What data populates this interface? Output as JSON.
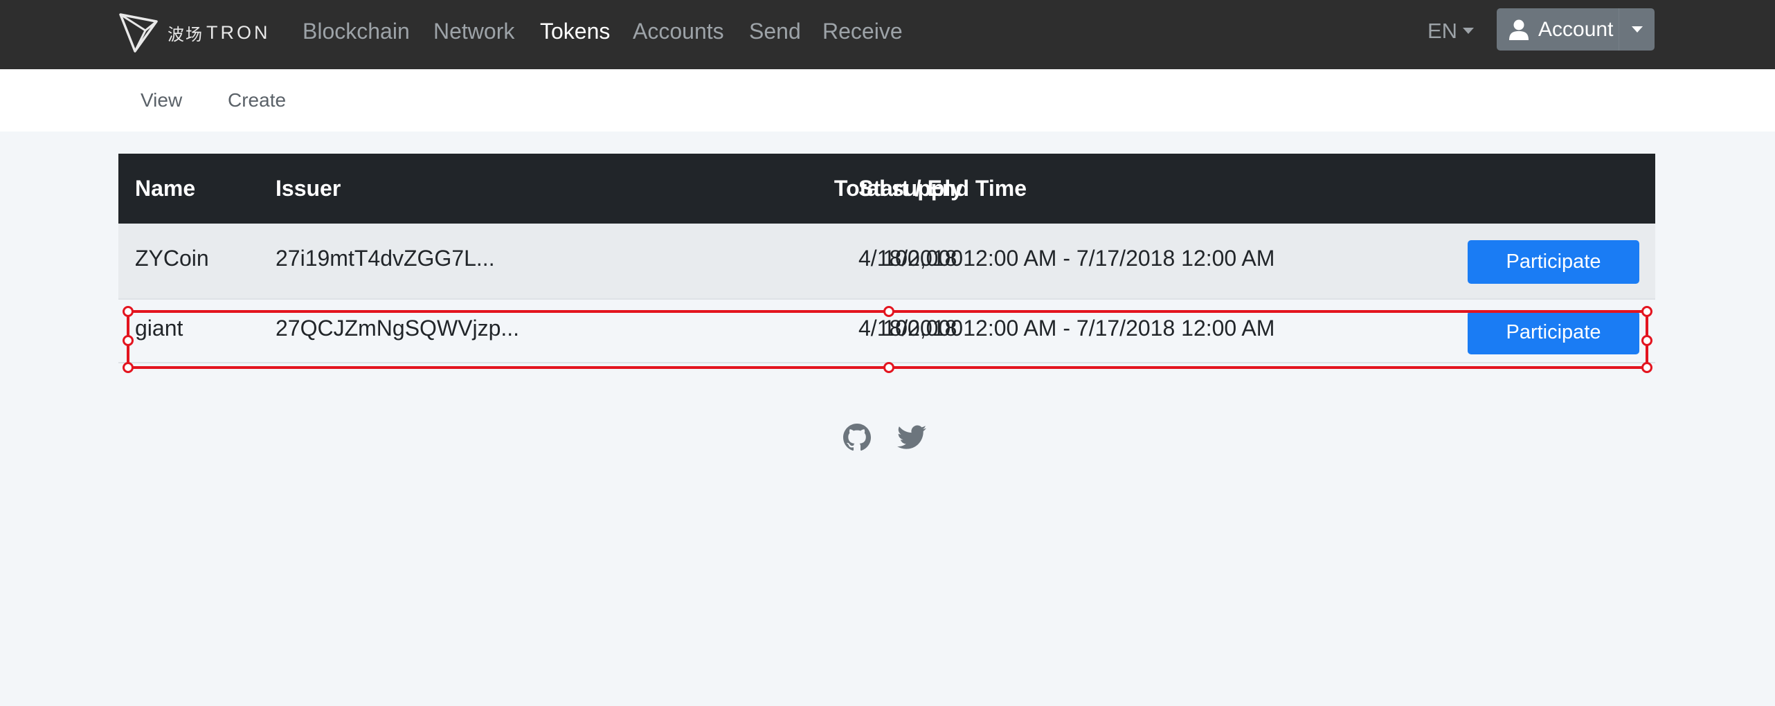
{
  "brand": {
    "cn_text": "波场",
    "name": "TRON"
  },
  "nav": {
    "items": [
      {
        "label": "Blockchain",
        "active": false
      },
      {
        "label": "Network",
        "active": false
      },
      {
        "label": "Tokens",
        "active": true
      },
      {
        "label": "Accounts",
        "active": false
      },
      {
        "label": "Send",
        "active": false
      },
      {
        "label": "Receive",
        "active": false
      }
    ],
    "language": "EN",
    "account_label": "Account"
  },
  "subnav": {
    "items": [
      "View",
      "Create"
    ]
  },
  "table": {
    "headers": {
      "name": "Name",
      "issuer": "Issuer",
      "total_supply": "Total supply",
      "time": "Start / End Time"
    },
    "rows": [
      {
        "name": "ZYCoin",
        "issuer": "27i19mtT4dvZGG7L...",
        "total_supply": "100,000",
        "start": "4/18/2018 12:00 AM",
        "end": " - 7/17/2018 12:00 AM",
        "action": "Participate"
      },
      {
        "name": "giant",
        "issuer": "27QCJZmNgSQWVjzp...",
        "total_supply": "100,000",
        "start": "4/18/2018 12:00 AM",
        "end": " - 7/17/2018 12:00 AM",
        "action": "Participate"
      }
    ]
  },
  "icons": {
    "footer": [
      "github-icon",
      "twitter-icon"
    ],
    "account": "user-icon"
  },
  "colors": {
    "topbar": "#2e2e2e",
    "primary_button": "#1a7cf4",
    "selection": "#e3141f",
    "table_header": "#212529"
  }
}
